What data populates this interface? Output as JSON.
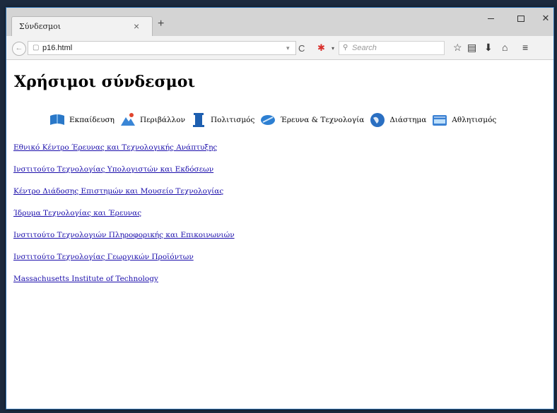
{
  "browser": {
    "tab_title": "Σύνδεσμοι",
    "tab_close": "×",
    "new_tab": "+",
    "url": "p16.html",
    "search_placeholder": "Search",
    "window_controls": [
      "minimize",
      "maximize",
      "close"
    ],
    "toolbar_icons": [
      "bookmark-star-icon",
      "bookmarks-list-icon",
      "download-icon",
      "home-icon",
      "menu-icon"
    ]
  },
  "page": {
    "title": "Χρήσιμοι σύνδεσμοι",
    "categories": [
      {
        "label": "Εκπαίδευση",
        "icon": "education-icon",
        "color": "#2a78c8"
      },
      {
        "label": "Περιβάλλον",
        "icon": "environment-icon",
        "color": "#3a86d6"
      },
      {
        "label": "Πολιτισμός",
        "icon": "column-icon",
        "color": "#1e5fb0"
      },
      {
        "label": "Έρευνα & Τεχνολογία",
        "icon": "research-icon",
        "color": "#2d7fd2"
      },
      {
        "label": "Διάστημα",
        "icon": "globe-icon",
        "color": "#2a6fc2"
      },
      {
        "label": "Αθλητισμός",
        "icon": "stadium-icon",
        "color": "#3b82d4"
      }
    ],
    "links": [
      "Εθνικό Κέντρο Έρευνας και Τεχνολογικής Ανάπτυξης",
      "Ινστιτούτο Τεχνολογίας Υπολογιστών και Εκδόσεων",
      "Κέντρο Διάδοσης Επιστημών και Μουσείο Τεχνολογίας",
      "Ίδρυμα Τεχνολογίας και Έρευνας",
      "Ινστιτούτο Τεχνολογιών Πληροφορικής και Επικοινωνιών",
      "Ινστιτούτο Τεχνολογίας Γεωργικών Προϊόντων",
      "Massachusetts Institute of Technology"
    ]
  },
  "colors": {
    "link": "#1a0dab",
    "chrome": "#d4d4d4",
    "desktop": "#1c2a3e"
  }
}
